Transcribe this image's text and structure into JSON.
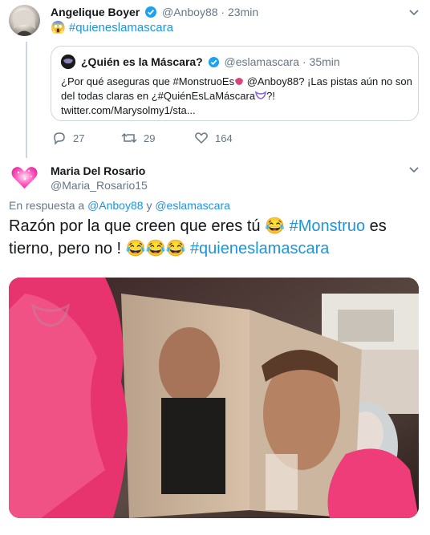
{
  "tweet1": {
    "display_name": "Angelique Boyer",
    "handle": "@Anboy88",
    "separator": "·",
    "time": "23min",
    "text_emoji": "😱",
    "text_hashtag": "#quieneslamascara"
  },
  "quote": {
    "display_name": "¿Quién es la Máscara?",
    "handle": "@eslamascara",
    "separator": "·",
    "time": "35min",
    "body_1": "¿Por qué aseguras que #MonstruoEs",
    "body_2": " @Anboy88? ¡Las pistas aún no son del todas claras en ¿#QuiénEsLaMáscara",
    "body_3": "?!",
    "body_4": "twitter.com/Marysolmy1/sta..."
  },
  "actions": {
    "replies": "27",
    "retweets": "29",
    "likes": "164"
  },
  "tweet2": {
    "display_name": "Maria Del Rosario",
    "handle": "@Maria_Rosario15",
    "reply_prefix": "En respuesta a",
    "reply_user1": "@Anboy88",
    "reply_and": "y",
    "reply_user2": "@eslamascara",
    "text_1": "Razón por la que creen que eres tú",
    "emoji_1": "😂",
    "hashtag_1": "#Monstruo",
    "text_2": " es tierno, pero no !",
    "emoji_2": "😂😂😂",
    "hashtag_2": "#quieneslamascara"
  },
  "colors": {
    "link": "#1b95e0",
    "verified": "#1da1f2",
    "muted": "#657786",
    "border": "#ccd6dd"
  }
}
